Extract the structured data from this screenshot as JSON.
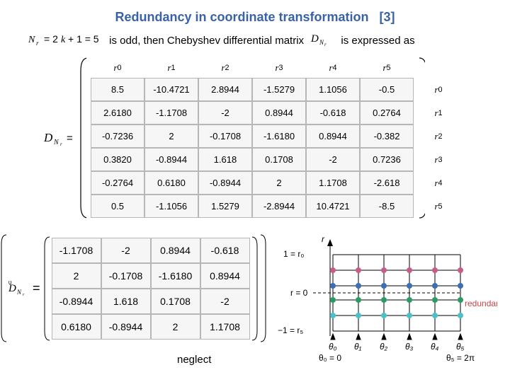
{
  "title_main": "Redundancy in coordinate transformation",
  "title_ref": "[3]",
  "text_is_odd": "is odd, then Chebyshev differential matrix",
  "text_is_expressed": "is expressed as",
  "eq_sign": "=",
  "chart_data": {
    "type": "table",
    "big_matrix": {
      "col_headers": [
        "r0",
        "r1",
        "r2",
        "r3",
        "r4",
        "r5"
      ],
      "row_headers": [
        "r0",
        "r1",
        "r2",
        "r3",
        "r4",
        "r5"
      ],
      "rows": [
        [
          "8.5",
          "-10.4721",
          "2.8944",
          "-1.5279",
          "1.1056",
          "-0.5"
        ],
        [
          "2.6180",
          "-1.1708",
          "-2",
          "0.8944",
          "-0.618",
          "0.2764"
        ],
        [
          "-0.7236",
          "2",
          "-0.1708",
          "-1.6180",
          "0.8944",
          "-0.382"
        ],
        [
          "0.3820",
          "-0.8944",
          "1.618",
          "0.1708",
          "-2",
          "0.7236"
        ],
        [
          "-0.2764",
          "0.6180",
          "-0.8944",
          "2",
          "1.1708",
          "-2.618"
        ],
        [
          "0.5",
          "-1.1056",
          "1.5279",
          "-2.8944",
          "10.4721",
          "-8.5"
        ]
      ]
    },
    "small_matrix": {
      "rows": [
        [
          "-1.1708",
          "-2",
          "0.8944",
          "-0.618"
        ],
        [
          "2",
          "-0.1708",
          "-1.6180",
          "0.8944"
        ],
        [
          "-0.8944",
          "1.618",
          "0.1708",
          "-2"
        ],
        [
          "0.6180",
          "-0.8944",
          "2",
          "1.1708"
        ]
      ]
    }
  },
  "neglect": "neglect",
  "diagram": {
    "r_axis": "r",
    "r_top": "1 = r₀",
    "r_mid": "r = 0",
    "r_bot": "−1 = r₅",
    "redundant": "redundant",
    "theta_labels": [
      "θ₀",
      "θ₁",
      "θ₂",
      "θ₃",
      "θ₄",
      "θ₅"
    ],
    "theta_left_note": "θ₀ = 0",
    "theta_right_note": "θ₅ = 2π"
  }
}
